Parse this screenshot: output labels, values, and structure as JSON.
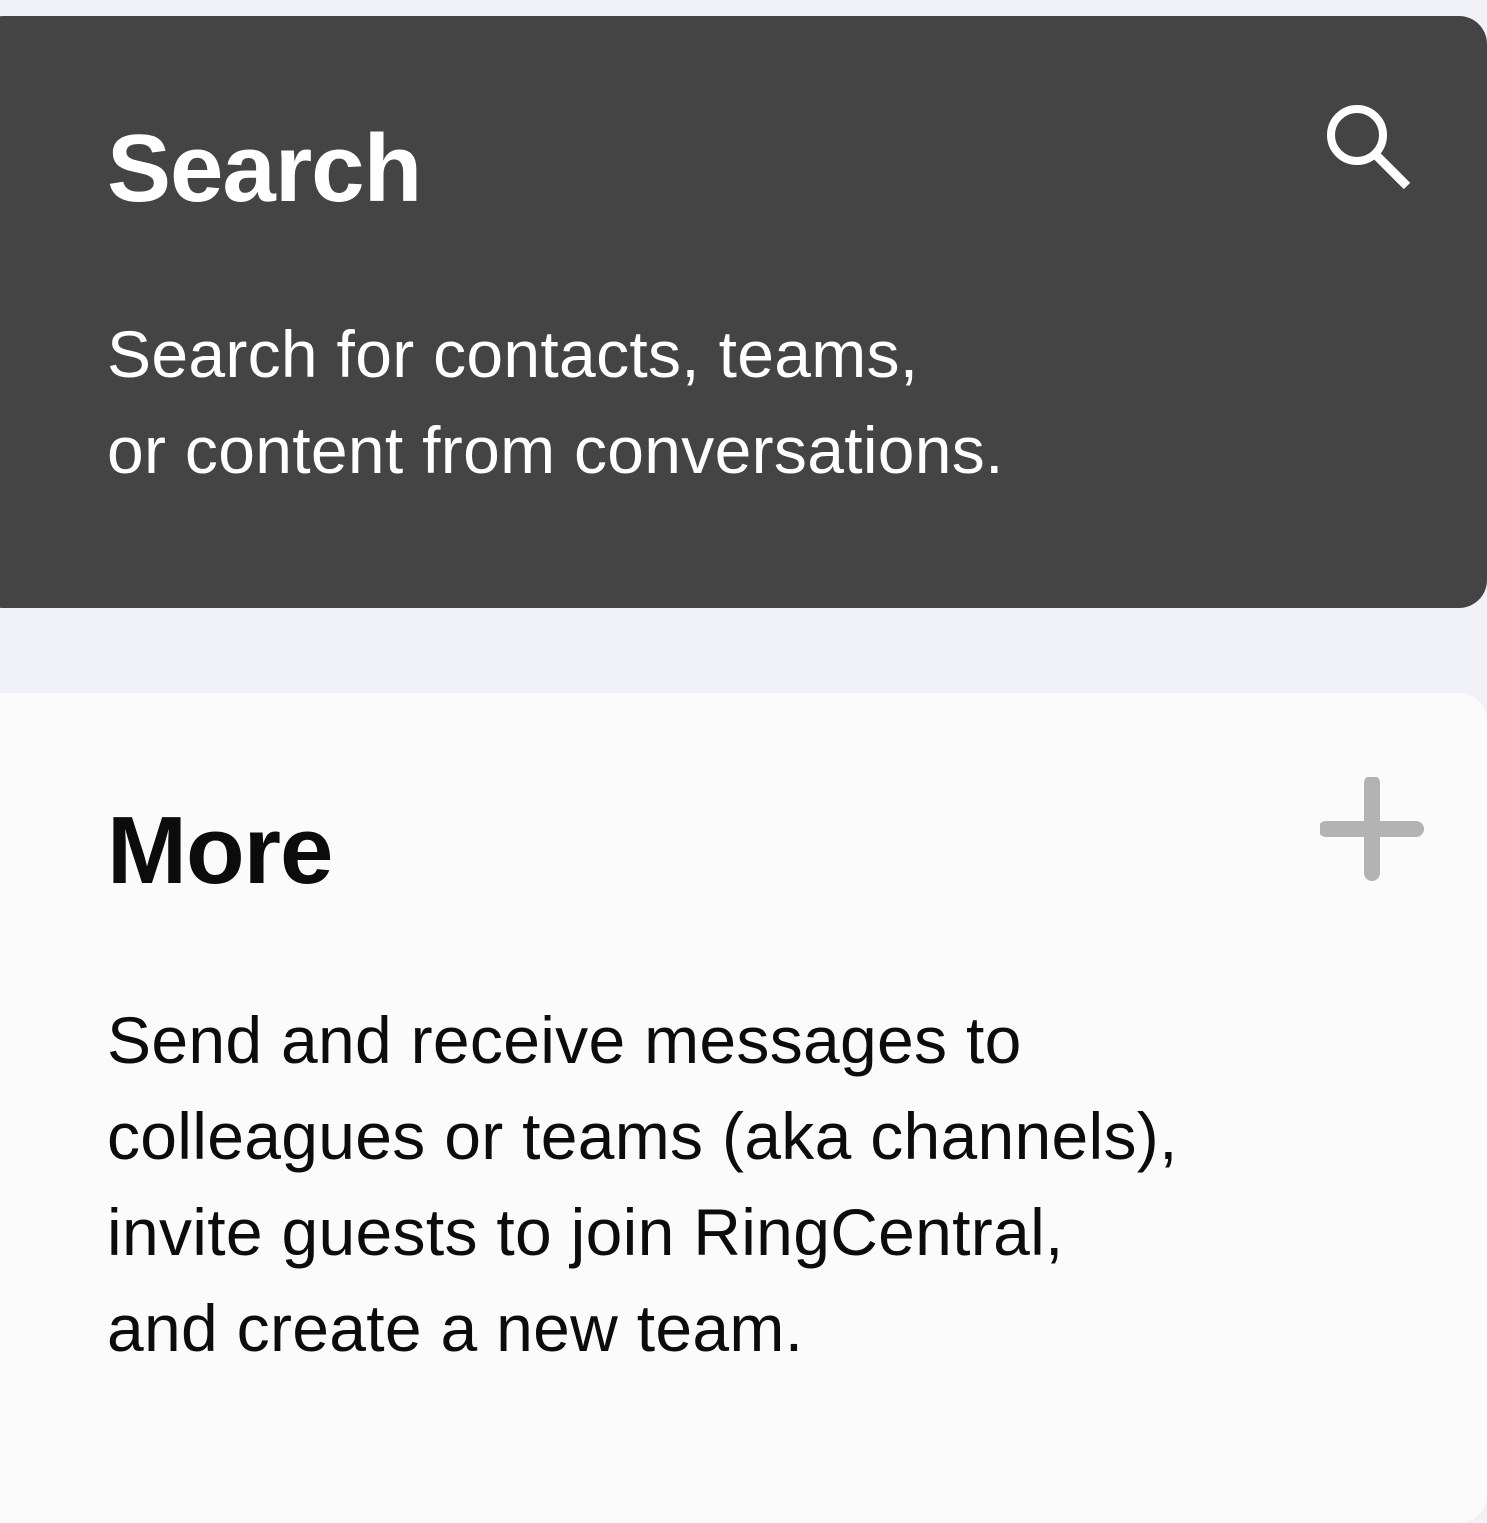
{
  "search_card": {
    "title": "Search",
    "description": "Search for contacts, teams,\nor content from conversations.",
    "icon": "search-icon",
    "background_color": "#444444",
    "text_color": "#ffffff"
  },
  "more_card": {
    "title": "More",
    "description": "Send and receive messages to\ncolleagues or teams (aka channels),\ninvite guests to join RingCentral,\nand create a new team.",
    "icon": "plus-icon",
    "icon_color": "#b3b3b3",
    "background_color": "#fbfbfc",
    "text_color": "#0c0c0c"
  },
  "page": {
    "background_color": "#f1f2f7"
  }
}
